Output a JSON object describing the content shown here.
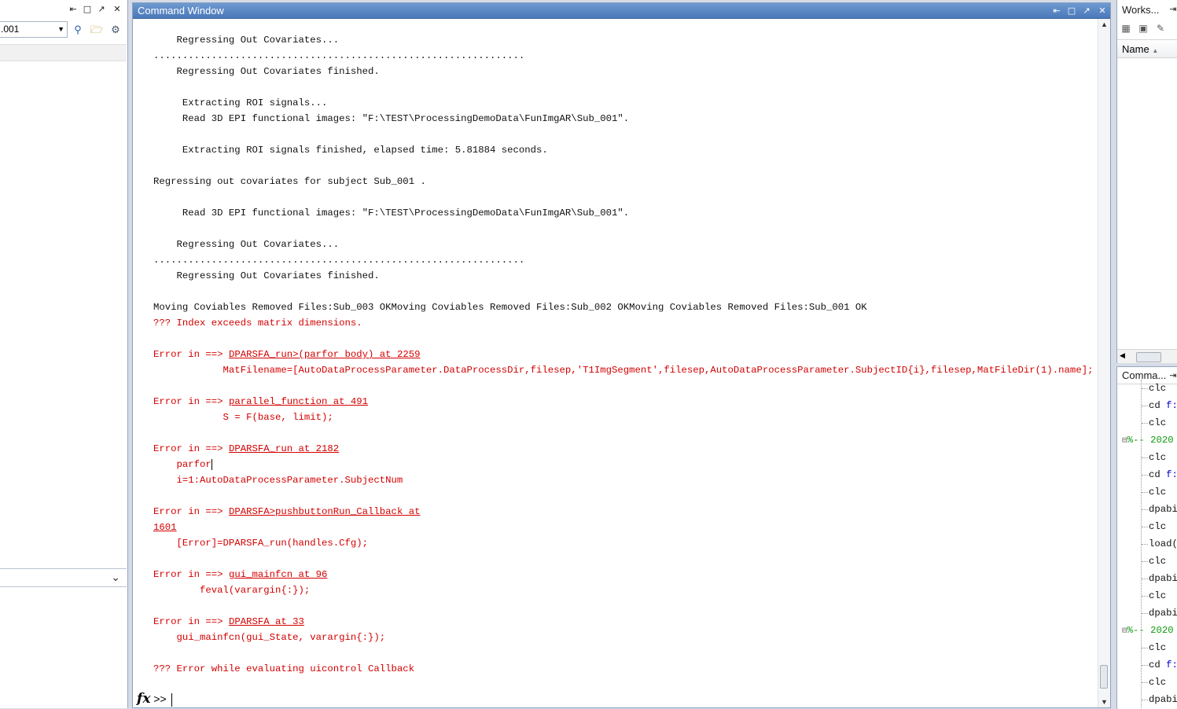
{
  "left_panel": {
    "path_value": ".001",
    "controls": [
      "unpin-icon",
      "maximize-icon",
      "undock-icon",
      "close-icon"
    ]
  },
  "command_window": {
    "title": "Command Window",
    "lines": [
      {
        "text": "    Regressing Out Covariates...",
        "style": "normal"
      },
      {
        "text": "................................................................",
        "style": "normal"
      },
      {
        "text": "    Regressing Out Covariates finished.",
        "style": "normal"
      },
      {
        "text": "",
        "style": "normal"
      },
      {
        "text": "     Extracting ROI signals...",
        "style": "normal"
      },
      {
        "text": "     Read 3D EPI functional images: \"F:\\TEST\\ProcessingDemoData\\FunImgAR\\Sub_001\".",
        "style": "normal"
      },
      {
        "text": "",
        "style": "normal"
      },
      {
        "text": "     Extracting ROI signals finished, elapsed time: 5.81884 seconds.",
        "style": "normal"
      },
      {
        "text": "",
        "style": "normal"
      },
      {
        "text": "Regressing out covariates for subject Sub_001 .",
        "style": "normal"
      },
      {
        "text": "",
        "style": "normal"
      },
      {
        "text": "     Read 3D EPI functional images: \"F:\\TEST\\ProcessingDemoData\\FunImgAR\\Sub_001\".",
        "style": "normal"
      },
      {
        "text": "",
        "style": "normal"
      },
      {
        "text": "    Regressing Out Covariates...",
        "style": "normal"
      },
      {
        "text": "................................................................",
        "style": "normal"
      },
      {
        "text": "    Regressing Out Covariates finished.",
        "style": "normal"
      },
      {
        "text": "",
        "style": "normal"
      },
      {
        "text": "Moving Coviables Removed Files:Sub_003 OKMoving Coviables Removed Files:Sub_002 OKMoving Coviables Removed Files:Sub_001 OK",
        "style": "normal"
      },
      {
        "text": "??? Index exceeds matrix dimensions.",
        "style": "err"
      },
      {
        "text": "",
        "style": "normal"
      },
      {
        "text": "Error in ==> ",
        "link": "DPARSFA_run>(parfor body) at 2259",
        "style": "err"
      },
      {
        "text": "            MatFilename=[AutoDataProcessParameter.DataProcessDir,filesep,'T1ImgSegment',filesep,AutoDataProcessParameter.SubjectID{i},filesep,MatFileDir(1).name];",
        "style": "err"
      },
      {
        "text": "",
        "style": "normal"
      },
      {
        "text": "Error in ==> ",
        "link": "parallel_function at 491",
        "style": "err"
      },
      {
        "text": "            S = F(base, limit);",
        "style": "err"
      },
      {
        "text": "",
        "style": "normal"
      },
      {
        "text": "Error in ==> ",
        "link": "DPARSFA_run at 2182",
        "style": "err"
      },
      {
        "text": "    parfor",
        "style": "err",
        "caret": true
      },
      {
        "text": "    i=1:AutoDataProcessParameter.SubjectNum",
        "style": "err"
      },
      {
        "text": "",
        "style": "normal"
      },
      {
        "text": "Error in ==> ",
        "link": "DPARSFA>pushbuttonRun_Callback at",
        "style": "err"
      },
      {
        "text": "",
        "link": "1601",
        "style": "err"
      },
      {
        "text": "    [Error]=DPARSFA_run(handles.Cfg);",
        "style": "err"
      },
      {
        "text": "",
        "style": "normal"
      },
      {
        "text": "Error in ==> ",
        "link": "gui_mainfcn at 96",
        "style": "err"
      },
      {
        "text": "        feval(varargin{:});",
        "style": "err"
      },
      {
        "text": "",
        "style": "normal"
      },
      {
        "text": "Error in ==> ",
        "link": "DPARSFA at 33",
        "style": "err"
      },
      {
        "text": "    gui_mainfcn(gui_State, varargin{:});",
        "style": "err"
      },
      {
        "text": "",
        "style": "normal"
      },
      {
        "text": "??? Error while evaluating uicontrol Callback",
        "style": "err"
      }
    ],
    "prompt": ">>",
    "fx_label": "fx"
  },
  "workspace": {
    "title": "Works...",
    "column_name": "Name"
  },
  "history": {
    "title": "Comma...",
    "items": [
      {
        "type": "cmd",
        "text": "clc"
      },
      {
        "type": "cmd",
        "text": "cd ",
        "blue": "f:"
      },
      {
        "type": "cmd",
        "text": "clc"
      },
      {
        "type": "section",
        "text": "%-- 2020"
      },
      {
        "type": "cmd",
        "text": "clc"
      },
      {
        "type": "cmd",
        "text": "cd ",
        "blue": "f:"
      },
      {
        "type": "cmd",
        "text": "clc"
      },
      {
        "type": "cmd",
        "text": "dpabi"
      },
      {
        "type": "cmd",
        "text": "clc"
      },
      {
        "type": "cmd",
        "text": "load("
      },
      {
        "type": "cmd",
        "text": "clc"
      },
      {
        "type": "cmd",
        "text": "dpabi"
      },
      {
        "type": "cmd",
        "text": "clc"
      },
      {
        "type": "cmd",
        "text": "dpabi"
      },
      {
        "type": "section",
        "text": "%-- 2020"
      },
      {
        "type": "cmd",
        "text": "clc"
      },
      {
        "type": "cmd",
        "text": "cd ",
        "blue": "f:"
      },
      {
        "type": "cmd",
        "text": "clc"
      },
      {
        "type": "cmd",
        "text": "dpabi"
      }
    ]
  }
}
